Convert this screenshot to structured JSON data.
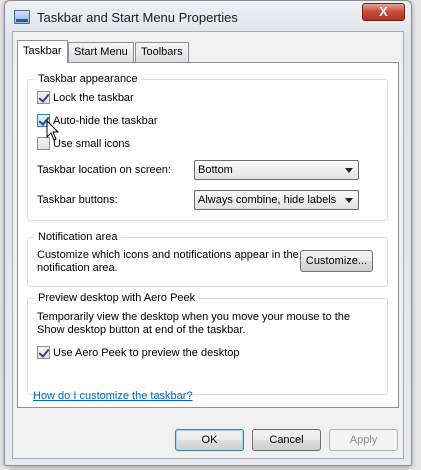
{
  "window": {
    "title": "Taskbar and Start Menu Properties",
    "close_label": "X"
  },
  "tabs": [
    {
      "label": "Taskbar",
      "active": true
    },
    {
      "label": "Start Menu",
      "active": false
    },
    {
      "label": "Toolbars",
      "active": false
    }
  ],
  "appearance": {
    "group_title": "Taskbar appearance",
    "lock_label": "Lock the taskbar",
    "lock_checked": true,
    "autohide_label": "Auto-hide the taskbar",
    "autohide_checked": true,
    "small_icons_label": "Use small icons",
    "small_icons_checked": false,
    "location_label": "Taskbar location on screen:",
    "location_value": "Bottom",
    "buttons_label": "Taskbar buttons:",
    "buttons_value": "Always combine, hide labels"
  },
  "notification": {
    "group_title": "Notification area",
    "description_line1": "Customize which icons and notifications appear in the",
    "description_line2": "notification area.",
    "customize_label": "Customize..."
  },
  "peek": {
    "group_title": "Preview desktop with Aero Peek",
    "description_line1": "Temporarily view the desktop when you move your mouse to the",
    "description_line2": "Show desktop button at end of the taskbar.",
    "aero_peek_label": "Use Aero Peek to preview the desktop",
    "aero_peek_checked": true
  },
  "help_link": "How do I customize the taskbar?",
  "footer": {
    "ok_label": "OK",
    "cancel_label": "Cancel",
    "apply_label": "Apply"
  },
  "colors": {
    "link": "#0066cc",
    "close_button": "#c44b37"
  }
}
